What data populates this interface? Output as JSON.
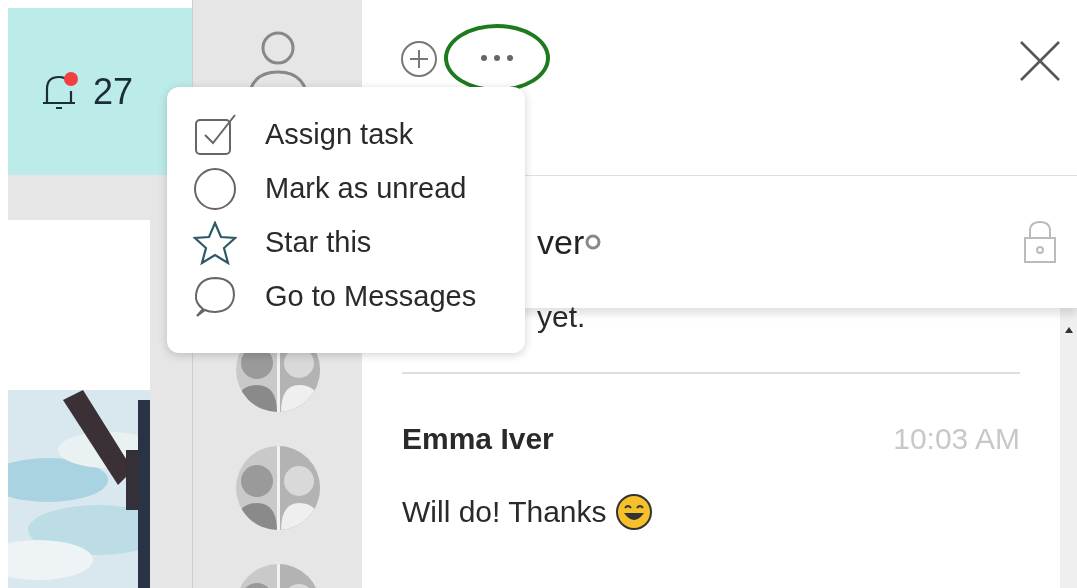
{
  "notifications": {
    "count": "27",
    "unread": true
  },
  "avatars": [
    {
      "kind": "person"
    },
    {
      "kind": "group"
    },
    {
      "kind": "group"
    },
    {
      "kind": "group"
    }
  ],
  "menu": {
    "items": [
      {
        "kind": "task",
        "label": "Assign task"
      },
      {
        "kind": "unread",
        "label": "Mark as unread"
      },
      {
        "kind": "star",
        "label": "Star this"
      },
      {
        "kind": "messages",
        "label": "Go to Messages"
      }
    ]
  },
  "conversation": {
    "title": "ver",
    "preview": "yet.",
    "messages": [
      {
        "sender": "Emma Iver",
        "time": "10:03 AM",
        "text": "Will do! Thanks"
      }
    ]
  }
}
